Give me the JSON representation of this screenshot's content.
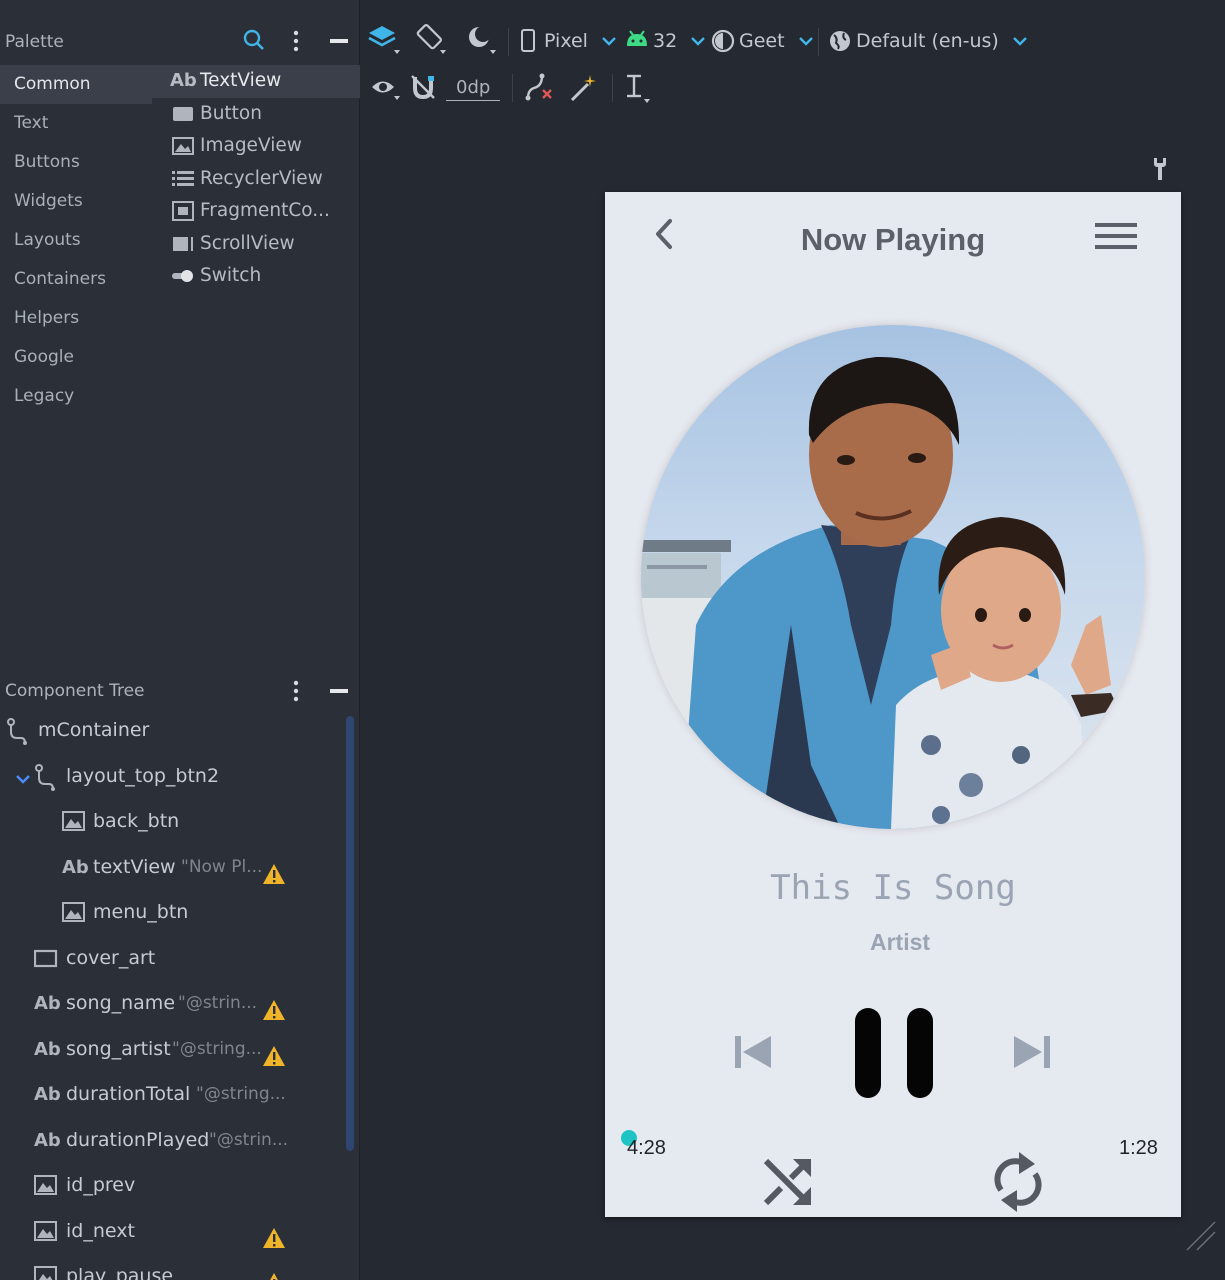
{
  "palette": {
    "title": "Palette",
    "categories": [
      "Common",
      "Text",
      "Buttons",
      "Widgets",
      "Layouts",
      "Containers",
      "Helpers",
      "Google",
      "Legacy"
    ],
    "widgets": [
      {
        "icon": "Ab",
        "label": "TextView"
      },
      {
        "icon": "button-icon",
        "label": "Button"
      },
      {
        "icon": "image-icon",
        "label": "ImageView"
      },
      {
        "icon": "list-icon",
        "label": "RecyclerView"
      },
      {
        "icon": "fragment-icon",
        "label": "FragmentCo..."
      },
      {
        "icon": "scroll-icon",
        "label": "ScrollView"
      },
      {
        "icon": "switch-icon",
        "label": "Switch"
      }
    ]
  },
  "toolbar": {
    "device": "Pixel",
    "api": "32",
    "theme": "Geet",
    "locale": "Default (en-us)",
    "margin": "0dp"
  },
  "tree": {
    "title": "Component Tree",
    "nodes": [
      {
        "icon": "constraint-icon",
        "name": "mContainer",
        "value": "",
        "warn": false
      },
      {
        "icon": "constraint-icon",
        "name": "layout_top_btn2",
        "value": "",
        "warn": false
      },
      {
        "icon": "image-icon",
        "name": "back_btn",
        "value": "",
        "warn": false
      },
      {
        "icon": "Ab",
        "name": "textView",
        "value": "\"Now Pl...",
        "warn": true
      },
      {
        "icon": "image-icon",
        "name": "menu_btn",
        "value": "",
        "warn": false
      },
      {
        "icon": "frame-icon",
        "name": "cover_art",
        "value": "",
        "warn": false
      },
      {
        "icon": "Ab",
        "name": "song_name",
        "value": "\"@strin...",
        "warn": true
      },
      {
        "icon": "Ab",
        "name": "song_artist",
        "value": "\"@string...",
        "warn": true
      },
      {
        "icon": "Ab",
        "name": "durationTotal",
        "value": "\"@string...",
        "warn": false
      },
      {
        "icon": "Ab",
        "name": "durationPlayed",
        "value": "\"@strin...",
        "warn": false
      },
      {
        "icon": "image-icon",
        "name": "id_prev",
        "value": "",
        "warn": false
      },
      {
        "icon": "image-icon",
        "name": "id_next",
        "value": "",
        "warn": true
      },
      {
        "icon": "image-icon",
        "name": "play_pause",
        "value": "",
        "warn": true
      }
    ]
  },
  "phone": {
    "title": "Now Playing",
    "song_name": "This Is Song",
    "artist": "Artist",
    "duration_played": "4:28",
    "duration_total": "1:28"
  },
  "colors": {
    "accent": "#1ec4c4",
    "ide_bg": "#252932",
    "panel_bg": "#2b2f38",
    "phone_bg": "#e5e9f0",
    "warning": "#f0b429",
    "android_green": "#3ddc84"
  }
}
